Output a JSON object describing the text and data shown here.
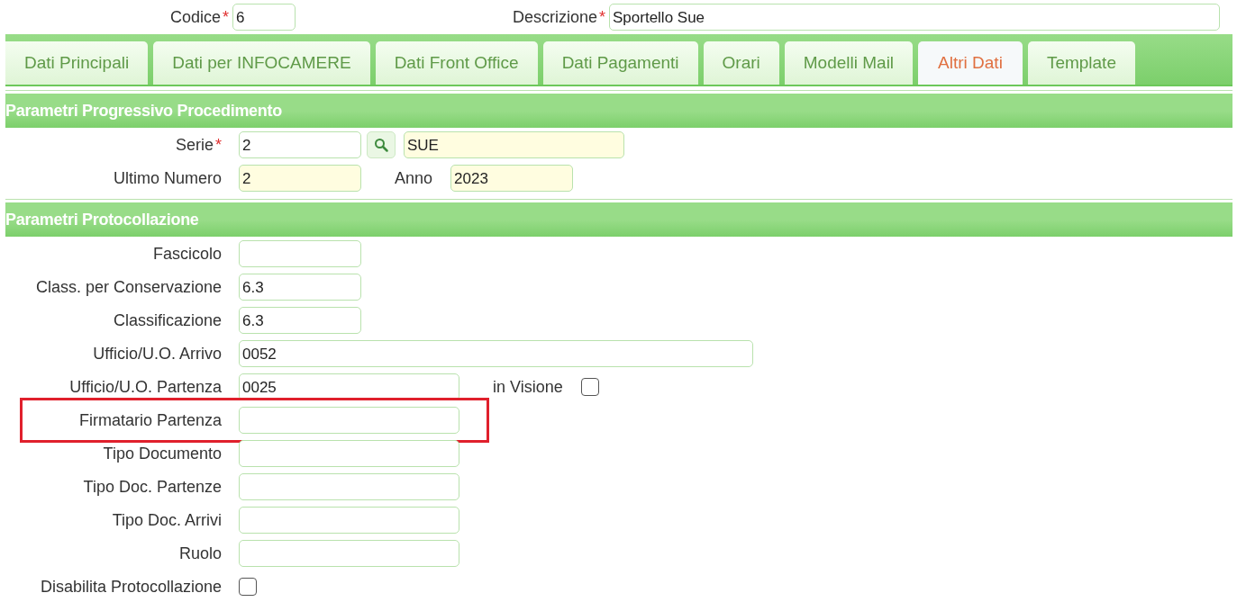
{
  "header": {
    "fields": [
      {
        "label": "Codice",
        "mark": "*",
        "value": "6"
      },
      {
        "label": "Descrizione",
        "mark": "*",
        "value": "Sportello Sue"
      }
    ]
  },
  "tabs": [
    {
      "label": "Dati Principali",
      "selected": false
    },
    {
      "label": "Dati per INFOCAMERE",
      "selected": false
    },
    {
      "label": "Dati Front Office",
      "selected": false
    },
    {
      "label": "Dati Pagamenti",
      "selected": false
    },
    {
      "label": "Orari",
      "selected": false
    },
    {
      "label": "Modelli Mail",
      "selected": false
    },
    {
      "label": "Altri Dati",
      "selected": true
    },
    {
      "label": "Template",
      "selected": false
    }
  ],
  "sections": [
    {
      "title": "Parametri Progressivo Procedimento",
      "rows": [
        {
          "label": "Serie",
          "mark": "*",
          "highlighted": false,
          "items": [
            {
              "kind": "short",
              "value": "2",
              "readonly": false
            },
            {
              "kind": "lookup"
            },
            {
              "kind": "medium",
              "value": "SUE",
              "readonly": true
            }
          ]
        },
        {
          "label": "Ultimo Numero",
          "highlighted": false,
          "items": [
            {
              "kind": "short",
              "value": "2",
              "readonly": true
            },
            {
              "kind": "label",
              "text": "Anno"
            },
            {
              "kind": "short",
              "value": "2023",
              "readonly": true
            }
          ]
        }
      ]
    },
    {
      "title": "Parametri Protocollazione",
      "rows": [
        {
          "label": "Fascicolo",
          "highlighted": false,
          "items": [
            {
              "kind": "short",
              "readonly": false
            }
          ]
        },
        {
          "label": "Class. per Conservazione",
          "highlighted": false,
          "items": [
            {
              "kind": "short",
              "value": "6.3",
              "readonly": false
            }
          ]
        },
        {
          "label": "Classificazione",
          "highlighted": false,
          "items": [
            {
              "kind": "short",
              "value": "6.3",
              "readonly": false
            }
          ]
        },
        {
          "label": "Ufficio/U.O. Arrivo",
          "highlighted": false,
          "items": [
            {
              "kind": "long",
              "value": "0052",
              "readonly": false
            }
          ]
        },
        {
          "label": "Ufficio/U.O. Partenza",
          "highlighted": false,
          "items": [
            {
              "kind": "medium",
              "value": "0025",
              "readonly": false
            },
            {
              "kind": "label",
              "text": "in Visione"
            },
            {
              "kind": "checkbox",
              "checked": false
            }
          ]
        },
        {
          "label": "Firmatario Partenza",
          "highlighted": true,
          "items": [
            {
              "kind": "medium",
              "readonly": false
            }
          ]
        },
        {
          "label": "Tipo Documento",
          "highlighted": false,
          "items": [
            {
              "kind": "medium",
              "readonly": false
            }
          ]
        },
        {
          "label": "Tipo Doc. Partenze",
          "highlighted": false,
          "items": [
            {
              "kind": "medium",
              "readonly": false
            }
          ]
        },
        {
          "label": "Tipo Doc. Arrivi",
          "highlighted": false,
          "items": [
            {
              "kind": "medium",
              "readonly": false
            }
          ]
        },
        {
          "label": "Ruolo",
          "highlighted": false,
          "items": [
            {
              "kind": "medium",
              "readonly": false
            }
          ]
        },
        {
          "label": "Disabilita Protocollazione",
          "highlighted": false,
          "items": [
            {
              "kind": "checkbox",
              "checked": false
            }
          ]
        }
      ]
    }
  ]
}
